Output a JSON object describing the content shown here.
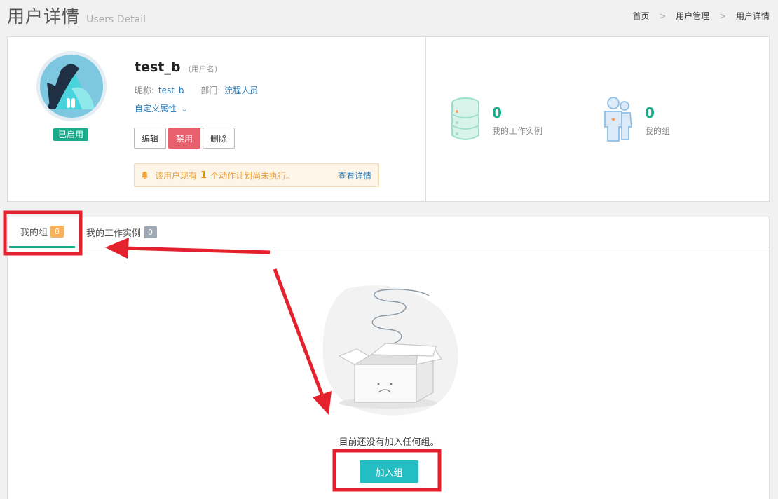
{
  "header": {
    "title": "用户详情",
    "subtitle": "Users Detail"
  },
  "breadcrumb": {
    "items": [
      "首页",
      "用户管理",
      "用户详情"
    ],
    "separator": ">"
  },
  "profile": {
    "status": "已启用",
    "username": "test_b",
    "username_hint": "(用户名)",
    "nickname_label": "昵称:",
    "nickname": "test_b",
    "department_label": "部门:",
    "department": "流程人员",
    "custom_attr_label": "自定义属性",
    "buttons": {
      "edit": "编辑",
      "disable": "禁用",
      "delete": "删除"
    },
    "alert": {
      "prefix": "该用户现有",
      "count": "1",
      "suffix": "个动作计划尚未执行。",
      "link": "查看详情"
    }
  },
  "stats": {
    "work_instances": {
      "value": "0",
      "label": "我的工作实例"
    },
    "groups": {
      "value": "0",
      "label": "我的组"
    }
  },
  "tabs": [
    {
      "label": "我的组",
      "count": "0",
      "active": true
    },
    {
      "label": "我的工作实例",
      "count": "0",
      "active": false
    }
  ],
  "empty_state": {
    "message": "目前还没有加入任何组。",
    "button": "加入组"
  },
  "colors": {
    "accent": "#1aab8a",
    "danger": "#e85f6e",
    "join_button": "#23bec4",
    "annotation": "#e5212d"
  }
}
